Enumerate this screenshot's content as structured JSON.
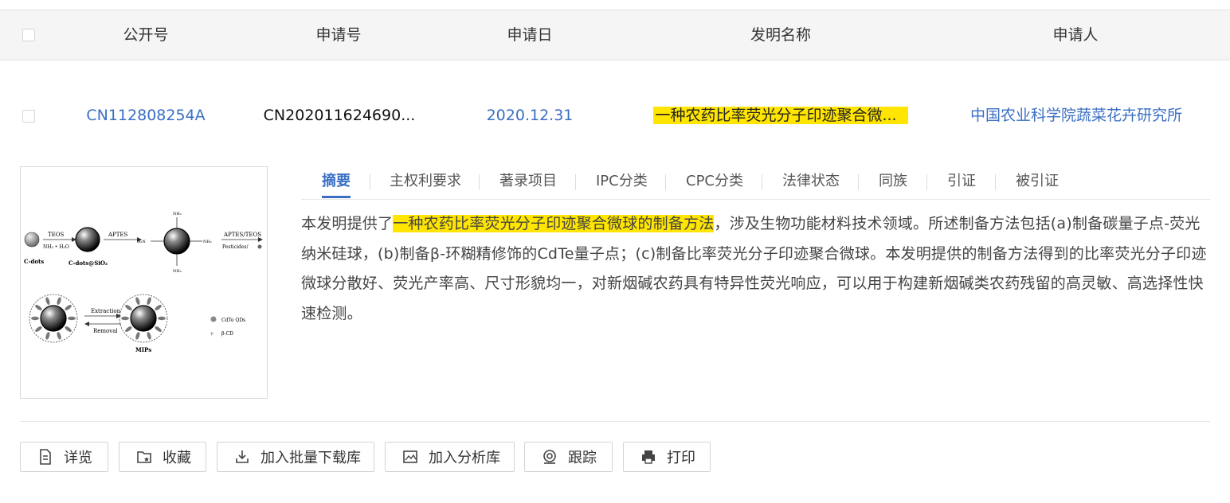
{
  "header": {
    "col_pub": "公开号",
    "col_app": "申请号",
    "col_date": "申请日",
    "col_title": "发明名称",
    "col_applicant": "申请人"
  },
  "row": {
    "pub_no": "CN112808254A",
    "app_no": "CN202011624690...",
    "app_date": "2020.12.31",
    "title": "一种农药比率荧光分子印迹聚合微...",
    "applicant": "中国农业科学院蔬菜花卉研究所"
  },
  "figure": {
    "teos": "TEOS",
    "nh3h2o": "NH₃ • H₂O",
    "aptes": "APTES",
    "aptes_teos": "APTES/TEOS",
    "pesticides": "Pesticides/",
    "cdots": "C-dots",
    "cdots_sio2": "C-dots@SiO₂",
    "nh2": "NH₂",
    "h2n": "H₂N",
    "extraction": "Extraction",
    "removal": "Removal",
    "mips": "MIPs",
    "legend_cdte": "CdTe QDs",
    "legend_cd": "β-CD"
  },
  "tabs": [
    {
      "label": "摘要"
    },
    {
      "label": "主权利要求"
    },
    {
      "label": "著录项目"
    },
    {
      "label": "IPC分类"
    },
    {
      "label": "CPC分类"
    },
    {
      "label": "法律状态"
    },
    {
      "label": "同族"
    },
    {
      "label": "引证"
    },
    {
      "label": "被引证"
    }
  ],
  "abstract": {
    "prefix": "本发明提供了",
    "highlight": "一种农药比率荧光分子印迹聚合微球的制备方法",
    "rest": "，涉及生物功能材料技术领域。所述制备方法包括(a)制备碳量子点-荧光纳米硅球，(b)制备β-环糊精修饰的CdTe量子点；(c)制备比率荧光分子印迹聚合微球。本发明提供的制备方法得到的比率荧光分子印迹微球分散好、荧光产率高、尺寸形貌均一，对新烟碱农药具有特异性荧光响应，可以用于构建新烟碱类农药残留的高灵敏、高选择性快速检测。"
  },
  "actions": {
    "detail": "详览",
    "favorite": "收藏",
    "batch_download": "加入批量下载库",
    "analysis": "加入分析库",
    "track": "跟踪",
    "print": "打印"
  },
  "colors": {
    "accent": "#3a6fc4",
    "highlight": "#ffe500"
  }
}
